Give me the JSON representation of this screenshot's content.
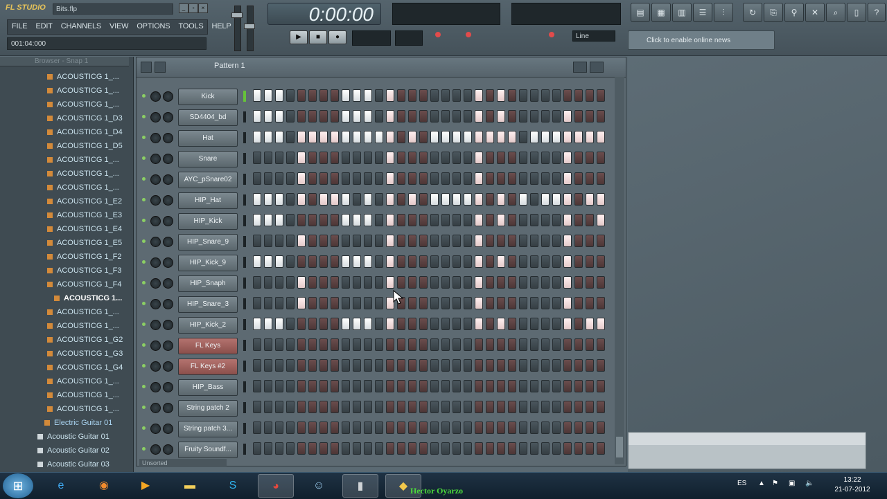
{
  "app": {
    "logo_text": "FL STUDIO",
    "project_title": "Bits.flp",
    "menu": [
      "FILE",
      "EDIT",
      "CHANNELS",
      "VIEW",
      "OPTIONS",
      "TOOLS",
      "HELP"
    ],
    "hint_text": "001:04:000",
    "time_display": "0:00:00",
    "tempo_mode": "Line",
    "news_text": "Click to enable online news"
  },
  "browser": {
    "title": "Browser - Snap 1",
    "items": [
      {
        "label": "ACOUSTICG 1_...",
        "type": "sample"
      },
      {
        "label": "ACOUSTICG 1_...",
        "type": "sample"
      },
      {
        "label": "ACOUSTICG 1_...",
        "type": "sample"
      },
      {
        "label": "ACOUSTICG 1_D3",
        "type": "sample"
      },
      {
        "label": "ACOUSTICG 1_D4",
        "type": "sample"
      },
      {
        "label": "ACOUSTICG 1_D5",
        "type": "sample"
      },
      {
        "label": "ACOUSTICG 1_...",
        "type": "sample"
      },
      {
        "label": "ACOUSTICG 1_...",
        "type": "sample"
      },
      {
        "label": "ACOUSTICG 1_...",
        "type": "sample"
      },
      {
        "label": "ACOUSTICG 1_E2",
        "type": "sample"
      },
      {
        "label": "ACOUSTICG 1_E3",
        "type": "sample"
      },
      {
        "label": "ACOUSTICG 1_E4",
        "type": "sample"
      },
      {
        "label": "ACOUSTICG 1_E5",
        "type": "sample"
      },
      {
        "label": "ACOUSTICG 1_F2",
        "type": "sample"
      },
      {
        "label": "ACOUSTICG 1_F3",
        "type": "sample"
      },
      {
        "label": "ACOUSTICG 1_F4",
        "type": "sample"
      },
      {
        "label": "ACOUSTICG 1...",
        "type": "selected"
      },
      {
        "label": "ACOUSTICG 1_...",
        "type": "sample"
      },
      {
        "label": "ACOUSTICG 1_...",
        "type": "sample"
      },
      {
        "label": "ACOUSTICG 1_G2",
        "type": "sample"
      },
      {
        "label": "ACOUSTICG 1_G3",
        "type": "sample"
      },
      {
        "label": "ACOUSTICG 1_G4",
        "type": "sample"
      },
      {
        "label": "ACOUSTICG 1_...",
        "type": "sample"
      },
      {
        "label": "ACOUSTICG 1_...",
        "type": "sample"
      },
      {
        "label": "ACOUSTICG 1_...",
        "type": "sample"
      },
      {
        "label": "Electric Guitar 01",
        "type": "folder"
      },
      {
        "label": "Acoustic Guitar 01",
        "type": "doc"
      },
      {
        "label": "Acoustic Guitar 02",
        "type": "doc"
      },
      {
        "label": "Acoustic Guitar 03",
        "type": "doc"
      }
    ]
  },
  "sequencer": {
    "pattern_name": "Pattern 1",
    "filter_label": "Unsorted",
    "channels": [
      {
        "name": "Kick",
        "color": "normal",
        "selected": true,
        "steps": [
          1,
          1,
          1,
          0,
          0,
          0,
          0,
          0,
          1,
          1,
          1,
          0,
          1,
          0,
          0,
          0,
          0,
          0,
          0,
          0,
          1,
          0,
          1,
          0,
          0,
          0,
          0,
          0,
          0,
          0,
          0,
          0,
          0,
          0,
          0,
          0,
          0,
          0,
          0,
          0,
          0,
          0,
          0,
          0,
          0,
          0,
          0,
          0,
          0,
          0,
          0,
          0,
          0,
          0,
          0,
          0,
          0,
          0,
          0,
          0,
          0,
          0,
          0,
          0
        ]
      },
      {
        "name": "SD4404_bd",
        "color": "normal",
        "selected": false,
        "steps": [
          1,
          1,
          1,
          0,
          0,
          0,
          0,
          0,
          1,
          1,
          1,
          0,
          1,
          0,
          0,
          0,
          0,
          0,
          0,
          0,
          1,
          0,
          1,
          0,
          0,
          0,
          0,
          0,
          1,
          0,
          0,
          0,
          0,
          0,
          0,
          0,
          0,
          0,
          0,
          0,
          0,
          0,
          0,
          0,
          0,
          0,
          0,
          0,
          0,
          0,
          0,
          0,
          0,
          0,
          0,
          0,
          0,
          0,
          0,
          0,
          0,
          0,
          0,
          0
        ]
      },
      {
        "name": "Hat",
        "color": "normal",
        "selected": false,
        "steps": [
          1,
          1,
          1,
          0,
          1,
          1,
          1,
          1,
          1,
          1,
          1,
          1,
          1,
          0,
          1,
          0,
          1,
          1,
          1,
          1,
          1,
          1,
          1,
          1,
          0,
          1,
          1,
          1,
          1,
          1,
          1,
          1,
          0,
          0,
          0,
          0,
          0,
          0,
          0,
          0,
          0,
          0,
          0,
          0,
          0,
          0,
          0,
          0,
          0,
          0,
          0,
          0,
          0,
          0,
          0,
          0,
          0,
          0,
          0,
          0,
          0,
          0,
          0,
          0
        ]
      },
      {
        "name": "Snare",
        "color": "normal",
        "selected": false,
        "steps": [
          0,
          0,
          0,
          0,
          1,
          0,
          0,
          0,
          0,
          0,
          0,
          0,
          1,
          0,
          0,
          0,
          0,
          0,
          0,
          0,
          1,
          0,
          0,
          0,
          0,
          0,
          0,
          0,
          1,
          0,
          0,
          0,
          0,
          0,
          0,
          0,
          0,
          0,
          0,
          0,
          0,
          0,
          0,
          0,
          0,
          0,
          0,
          0,
          0,
          0,
          0,
          0,
          0,
          0,
          0,
          0,
          0,
          0,
          0,
          0,
          0,
          0,
          0,
          0
        ]
      },
      {
        "name": "AYC_pSnare02",
        "color": "normal",
        "selected": false,
        "steps": [
          0,
          0,
          0,
          0,
          1,
          0,
          0,
          0,
          0,
          0,
          0,
          0,
          1,
          0,
          0,
          0,
          0,
          0,
          0,
          0,
          1,
          0,
          0,
          0,
          0,
          0,
          0,
          0,
          1,
          0,
          0,
          0,
          0,
          0,
          0,
          0,
          0,
          0,
          0,
          0,
          0,
          0,
          0,
          0,
          0,
          0,
          0,
          0,
          0,
          0,
          0,
          0,
          0,
          0,
          0,
          0,
          0,
          0,
          0,
          0,
          0,
          0,
          0,
          0
        ]
      },
      {
        "name": "HIP_Hat",
        "color": "normal",
        "selected": false,
        "steps": [
          1,
          1,
          1,
          0,
          1,
          0,
          1,
          1,
          1,
          0,
          1,
          0,
          1,
          0,
          1,
          0,
          1,
          1,
          1,
          1,
          1,
          0,
          1,
          0,
          1,
          0,
          1,
          1,
          1,
          0,
          1,
          1,
          0,
          0,
          0,
          0,
          0,
          0,
          0,
          0,
          0,
          0,
          0,
          0,
          0,
          0,
          0,
          0,
          0,
          0,
          0,
          0,
          0,
          0,
          0,
          0,
          0,
          0,
          0,
          0,
          0,
          0,
          0,
          0
        ]
      },
      {
        "name": "HIP_Kick",
        "color": "normal",
        "selected": false,
        "steps": [
          1,
          1,
          1,
          0,
          0,
          0,
          0,
          0,
          1,
          1,
          1,
          0,
          1,
          0,
          0,
          0,
          0,
          0,
          0,
          0,
          1,
          0,
          1,
          0,
          0,
          0,
          0,
          0,
          1,
          0,
          0,
          1,
          0,
          0,
          0,
          0,
          0,
          0,
          0,
          0,
          0,
          0,
          0,
          0,
          0,
          0,
          0,
          0,
          0,
          0,
          0,
          0,
          0,
          0,
          0,
          0,
          0,
          0,
          0,
          0,
          0,
          0,
          0,
          0
        ]
      },
      {
        "name": "HIP_Snare_9",
        "color": "normal",
        "selected": false,
        "steps": [
          0,
          0,
          0,
          0,
          1,
          0,
          0,
          0,
          0,
          0,
          0,
          0,
          1,
          0,
          0,
          0,
          0,
          0,
          0,
          0,
          1,
          0,
          0,
          0,
          0,
          0,
          0,
          0,
          1,
          0,
          0,
          0,
          0,
          0,
          0,
          0,
          0,
          0,
          0,
          0,
          0,
          0,
          0,
          0,
          0,
          0,
          0,
          0,
          0,
          0,
          0,
          0,
          0,
          0,
          0,
          0,
          0,
          0,
          0,
          0,
          0,
          0,
          0,
          0
        ]
      },
      {
        "name": "HIP_Kick_9",
        "color": "normal",
        "selected": false,
        "steps": [
          1,
          1,
          1,
          0,
          0,
          0,
          0,
          0,
          1,
          1,
          1,
          0,
          1,
          0,
          0,
          0,
          0,
          0,
          0,
          0,
          1,
          0,
          1,
          0,
          0,
          0,
          0,
          0,
          1,
          0,
          0,
          0,
          0,
          0,
          0,
          0,
          0,
          0,
          0,
          0,
          0,
          0,
          0,
          0,
          0,
          0,
          0,
          0,
          0,
          0,
          0,
          0,
          0,
          0,
          0,
          0,
          0,
          0,
          0,
          0,
          0,
          0,
          0,
          0
        ]
      },
      {
        "name": "HIP_Snaph",
        "color": "normal",
        "selected": false,
        "steps": [
          0,
          0,
          0,
          0,
          1,
          0,
          0,
          0,
          0,
          0,
          0,
          0,
          1,
          0,
          0,
          0,
          0,
          0,
          0,
          0,
          1,
          0,
          0,
          0,
          0,
          0,
          0,
          0,
          1,
          0,
          0,
          0,
          0,
          0,
          0,
          0,
          0,
          0,
          0,
          0,
          0,
          0,
          0,
          0,
          0,
          0,
          0,
          0,
          0,
          0,
          0,
          0,
          0,
          0,
          0,
          0,
          0,
          0,
          0,
          0,
          0,
          0,
          0,
          0
        ]
      },
      {
        "name": "HIP_Snare_3",
        "color": "normal",
        "selected": false,
        "steps": [
          0,
          0,
          0,
          0,
          1,
          0,
          0,
          0,
          0,
          0,
          0,
          0,
          1,
          0,
          0,
          0,
          0,
          0,
          0,
          0,
          1,
          0,
          0,
          0,
          0,
          0,
          0,
          0,
          1,
          0,
          0,
          0,
          0,
          0,
          0,
          0,
          0,
          0,
          0,
          0,
          0,
          0,
          0,
          0,
          0,
          0,
          0,
          0,
          0,
          0,
          0,
          0,
          0,
          0,
          0,
          0,
          0,
          0,
          0,
          0,
          0,
          0,
          0,
          0
        ]
      },
      {
        "name": "HIP_Kick_2",
        "color": "normal",
        "selected": false,
        "steps": [
          1,
          1,
          1,
          0,
          0,
          0,
          0,
          0,
          1,
          1,
          1,
          0,
          1,
          0,
          0,
          0,
          0,
          0,
          0,
          0,
          1,
          0,
          1,
          0,
          0,
          0,
          0,
          0,
          1,
          0,
          1,
          1,
          0,
          0,
          0,
          0,
          0,
          0,
          0,
          0,
          0,
          0,
          0,
          0,
          0,
          0,
          0,
          0,
          0,
          0,
          0,
          0,
          0,
          0,
          0,
          0,
          0,
          0,
          0,
          0,
          0,
          0,
          0,
          0
        ]
      },
      {
        "name": "FL Keys",
        "color": "red",
        "selected": false,
        "steps": [
          0,
          0,
          0,
          0,
          0,
          0,
          0,
          0,
          0,
          0,
          0,
          0,
          0,
          0,
          0,
          0,
          0,
          0,
          0,
          0,
          0,
          0,
          0,
          0,
          0,
          0,
          0,
          0,
          0,
          0,
          0,
          0
        ]
      },
      {
        "name": "FL Keys #2",
        "color": "red",
        "selected": false,
        "steps": [
          0,
          0,
          0,
          0,
          0,
          0,
          0,
          0,
          0,
          0,
          0,
          0,
          0,
          0,
          0,
          0,
          0,
          0,
          0,
          0,
          0,
          0,
          0,
          0,
          0,
          0,
          0,
          0,
          0,
          0,
          0,
          0
        ]
      },
      {
        "name": "HIP_Bass",
        "color": "normal",
        "selected": false,
        "steps": [
          0,
          0,
          0,
          0,
          0,
          0,
          0,
          0,
          0,
          0,
          0,
          0,
          0,
          0,
          0,
          0,
          0,
          0,
          0,
          0,
          0,
          0,
          0,
          0,
          0,
          0,
          0,
          0,
          0,
          0,
          0,
          0
        ]
      },
      {
        "name": "String patch 2",
        "color": "normal",
        "selected": false,
        "steps": [
          0,
          0,
          0,
          0,
          0,
          0,
          0,
          0,
          0,
          0,
          0,
          0,
          0,
          0,
          0,
          0,
          0,
          0,
          0,
          0,
          0,
          0,
          0,
          0,
          0,
          0,
          0,
          0,
          0,
          0,
          0,
          0
        ]
      },
      {
        "name": "String patch 3...",
        "color": "normal",
        "selected": false,
        "steps": [
          0,
          0,
          0,
          0,
          0,
          0,
          0,
          0,
          0,
          0,
          0,
          0,
          0,
          0,
          0,
          0,
          0,
          0,
          0,
          0,
          0,
          0,
          0,
          0,
          0,
          0,
          0,
          0,
          0,
          0,
          0,
          0
        ]
      },
      {
        "name": "Fruity Soundf...",
        "color": "normal",
        "selected": false,
        "steps": [
          0,
          0,
          0,
          0,
          0,
          0,
          0,
          0,
          0,
          0,
          0,
          0,
          0,
          0,
          0,
          0,
          0,
          0,
          0,
          0,
          0,
          0,
          0,
          0,
          0,
          0,
          0,
          0,
          0,
          0,
          0,
          0
        ]
      }
    ]
  },
  "taskbar": {
    "watermark": "Hector Oyarzo",
    "language": "ES",
    "time": "13:22",
    "date": "21-07-2012"
  }
}
